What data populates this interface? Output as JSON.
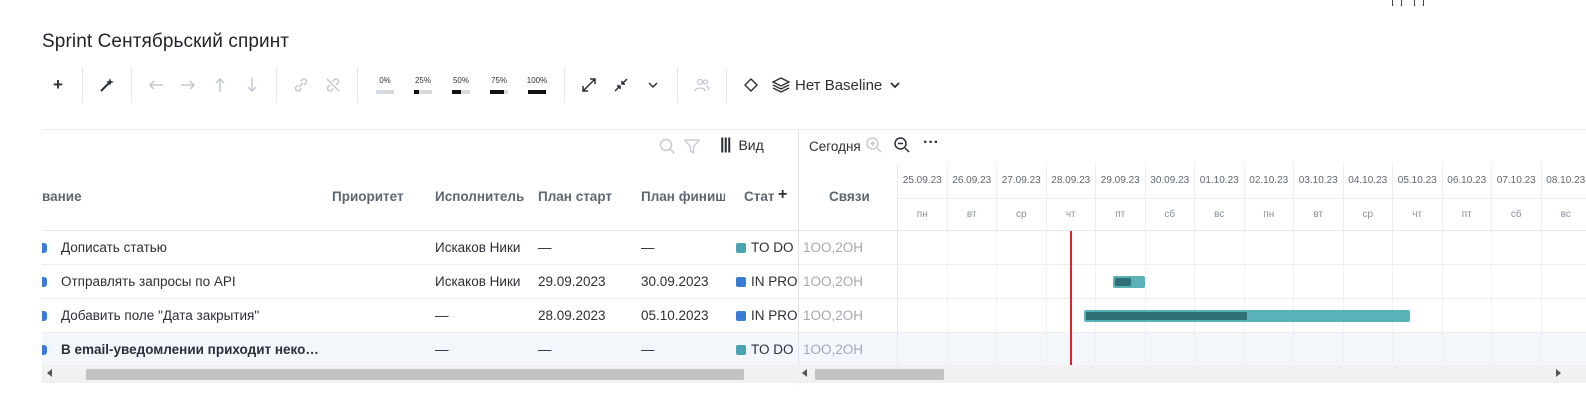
{
  "title": "Sprint Сентябрьский спринт",
  "toolbar": {
    "add_label": "+",
    "progress_options": [
      {
        "label": "0%",
        "fill": 0
      },
      {
        "label": "25%",
        "fill": 0.25
      },
      {
        "label": "50%",
        "fill": 0.5
      },
      {
        "label": "75%",
        "fill": 0.75
      },
      {
        "label": "100%",
        "fill": 1
      }
    ],
    "baseline_label": "Нет Baseline"
  },
  "left": {
    "view_label": "Вид",
    "columns": [
      "вание",
      "Приоритет",
      "Исполнитель",
      "План старт",
      "План финиш",
      "Стат"
    ],
    "add_column": "+",
    "rows": [
      {
        "name": "Дописать статью",
        "priority": "",
        "assignee": "Искаков Ники",
        "start": "—",
        "finish": "—",
        "status": "TO DO",
        "status_color": "#4aa3b0",
        "links": "1OO,2OH",
        "bold": false
      },
      {
        "name": "Отправлять запросы по API",
        "priority": "",
        "assignee": "Искаков Ники",
        "start": "29.09.2023",
        "finish": "30.09.2023",
        "status": "IN PRO",
        "status_color": "#3a7bd5",
        "links": "1OO,2OH",
        "bold": false
      },
      {
        "name": "Добавить поле \"Дата закрытия\"",
        "priority": "",
        "assignee": "—",
        "start": "28.09.2023",
        "finish": "05.10.2023",
        "status": "IN PRO",
        "status_color": "#3a7bd5",
        "links": "1OO,2OH",
        "bold": false
      },
      {
        "name": "В email-уведомлении приходит неко…",
        "priority": "",
        "assignee": "—",
        "start": "—",
        "finish": "—",
        "status": "TO DO",
        "status_color": "#4aa3b0",
        "links": "1OO,2OH",
        "bold": true
      }
    ]
  },
  "gantt": {
    "today_label": "Сегодня",
    "links_header": "Связи",
    "days": [
      {
        "date": "25.09.23",
        "wd": "пн"
      },
      {
        "date": "26.09.23",
        "wd": "вт"
      },
      {
        "date": "27.09.23",
        "wd": "ср"
      },
      {
        "date": "28.09.23",
        "wd": "чт"
      },
      {
        "date": "29.09.23",
        "wd": "пт"
      },
      {
        "date": "30.09.23",
        "wd": "сб"
      },
      {
        "date": "01.10.23",
        "wd": "вс"
      },
      {
        "date": "02.10.23",
        "wd": "пн"
      },
      {
        "date": "03.10.23",
        "wd": "вт"
      },
      {
        "date": "04.10.23",
        "wd": "ср"
      },
      {
        "date": "05.10.23",
        "wd": "чт"
      },
      {
        "date": "06.10.23",
        "wd": "пт"
      },
      {
        "date": "07.10.23",
        "wd": "сб"
      },
      {
        "date": "08.10.23",
        "wd": "вс"
      }
    ],
    "today_date": "28.09.23",
    "tasks": [
      null,
      {
        "start": "29.09.23",
        "end": "30.09.23",
        "progress": 0.55
      },
      {
        "start": "28.09.23",
        "end": "05.10.23",
        "progress": 0.5
      },
      null
    ]
  }
}
